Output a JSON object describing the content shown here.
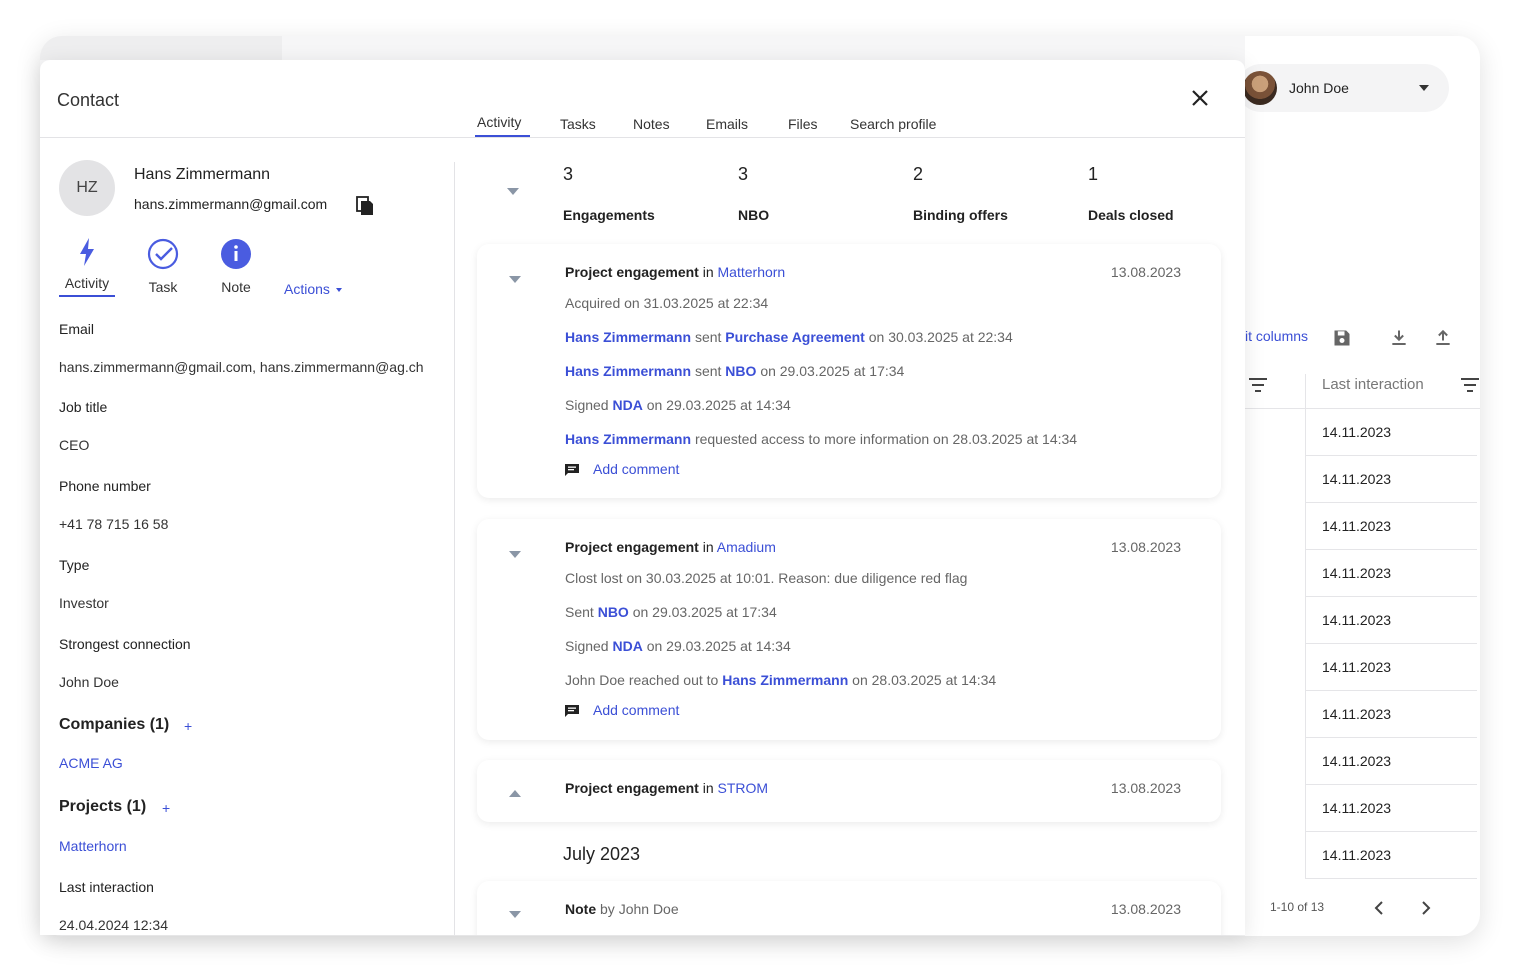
{
  "background": {
    "user_name": "John Doe",
    "edit_columns": "it columns",
    "column_title": "Last interaction",
    "rows": [
      "14.11.2023",
      "14.11.2023",
      "14.11.2023",
      "14.11.2023",
      "14.11.2023",
      "14.11.2023",
      "14.11.2023",
      "14.11.2023",
      "14.11.2023",
      "14.11.2023"
    ],
    "pager": "1-10 of 13"
  },
  "modal": {
    "title": "Contact",
    "tabs": [
      "Activity",
      "Tasks",
      "Notes",
      "Emails",
      "Files",
      "Search profile"
    ]
  },
  "contact": {
    "initials": "HZ",
    "name": "Hans Zimmermann",
    "email": "hans.zimmermann@gmail.com",
    "quick_actions": [
      "Activity",
      "Task",
      "Note"
    ],
    "actions_label": "Actions",
    "fields": [
      {
        "label": "Email",
        "value": "hans.zimmermann@gmail.com, hans.zimmermann@ag.ch"
      },
      {
        "label": "Job title",
        "value": "CEO"
      },
      {
        "label": "Phone number",
        "value": "+41 78 715 16 58"
      },
      {
        "label": "Type",
        "value": "Investor"
      },
      {
        "label": "Strongest connection",
        "value": "John Doe"
      }
    ],
    "companies_title": "Companies (1)",
    "company": "ACME AG",
    "projects_title": "Projects (1)",
    "project": "Matterhorn",
    "last_interaction_label": "Last interaction",
    "last_interaction_value": "24.04.2024 12:34"
  },
  "stats": [
    {
      "value": "3",
      "label": "Engagements"
    },
    {
      "value": "3",
      "label": "NBO"
    },
    {
      "value": "2",
      "label": "Binding offers"
    },
    {
      "value": "1",
      "label": "Deals closed"
    }
  ],
  "cards": {
    "c1": {
      "type": "Project engagement",
      "in": "in",
      "project": "Matterhorn",
      "date": "13.08.2023",
      "l1": "Acquired on 31.03.2025 at 22:34",
      "l2_a": "Hans Zimmermann",
      "l2_b": "sent",
      "l2_c": "Purchase Agreement",
      "l2_d": "on 30.03.2025 at 22:34",
      "l3_a": "Hans Zimmermann",
      "l3_b": "sent",
      "l3_c": "NBO",
      "l3_d": "on 29.03.2025 at 17:34",
      "l4_a": "Signed",
      "l4_b": "NDA",
      "l4_c": "on 29.03.2025 at 14:34",
      "l5_a": "Hans Zimmermann",
      "l5_b": "requested access to more information on 28.03.2025 at 14:34",
      "add_comment": "Add comment"
    },
    "c2": {
      "type": "Project engagement",
      "in": "in",
      "project": "Amadium",
      "date": "13.08.2023",
      "l1": "Clost lost on 30.03.2025 at 10:01. Reason: due diligence red flag",
      "l2_a": "Sent",
      "l2_b": "NBO",
      "l2_c": "on 29.03.2025 at 17:34",
      "l3_a": "Signed",
      "l3_b": "NDA",
      "l3_c": "on 29.03.2025 at 14:34",
      "l4_a": "John Doe reached out to",
      "l4_b": "Hans Zimmermann",
      "l4_c": "on 28.03.2025 at 14:34",
      "add_comment": "Add comment"
    },
    "c3": {
      "type": "Project engagement",
      "in": "in",
      "project": "STROM",
      "date": "13.08.2023"
    },
    "month": "July 2023",
    "c4": {
      "type": "Note",
      "by": "by John Doe",
      "date": "13.08.2023"
    }
  }
}
